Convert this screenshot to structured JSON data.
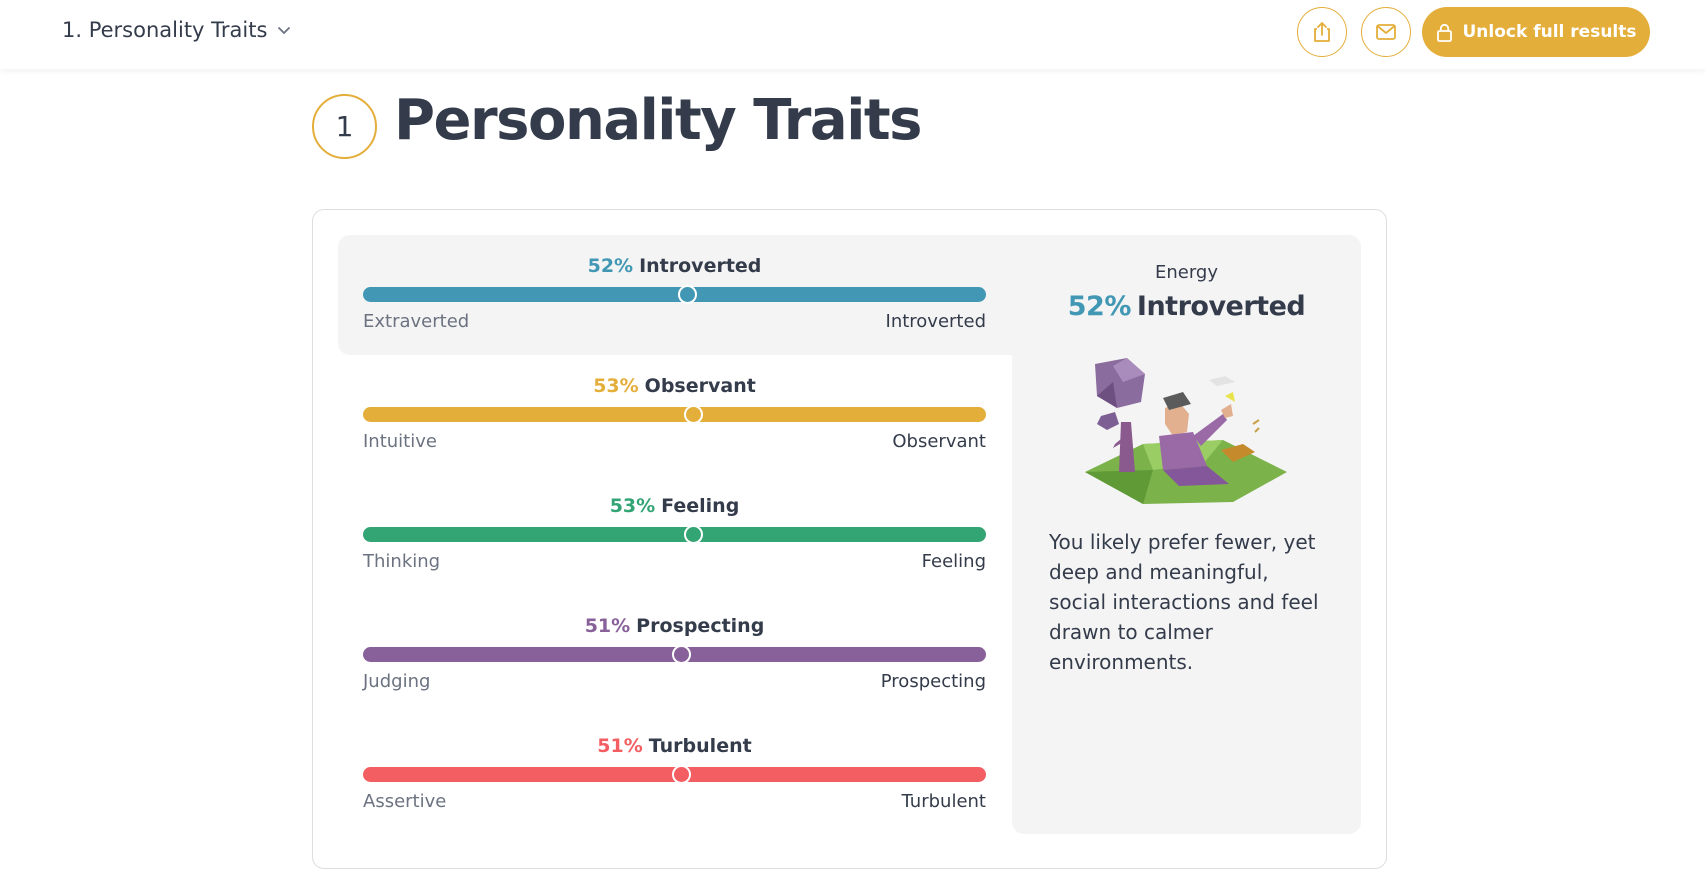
{
  "header": {
    "section_label": "1. Personality Traits",
    "unlock_label": "Unlock full results",
    "accent": "#e4ae3a"
  },
  "title": {
    "number": "1",
    "text": "Personality Traits"
  },
  "traits": [
    {
      "pct": "52%",
      "name": "Introverted",
      "left": "Extraverted",
      "right": "Introverted",
      "color": "#4298b4",
      "level": 52,
      "side": "right",
      "selected": true
    },
    {
      "pct": "53%",
      "name": "Observant",
      "left": "Intuitive",
      "right": "Observant",
      "color": "#e4ae3a",
      "level": 53,
      "side": "right"
    },
    {
      "pct": "53%",
      "name": "Feeling",
      "left": "Thinking",
      "right": "Feeling",
      "color": "#33a474",
      "level": 53,
      "side": "right"
    },
    {
      "pct": "51%",
      "name": "Prospecting",
      "left": "Judging",
      "right": "Prospecting",
      "color": "#88619a",
      "level": 51,
      "side": "right"
    },
    {
      "pct": "51%",
      "name": "Turbulent",
      "left": "Assertive",
      "right": "Turbulent",
      "color": "#f25e62",
      "level": 51,
      "side": "right"
    }
  ],
  "panel": {
    "category": "Energy",
    "pct": "52%",
    "name": "Introverted",
    "description": "You likely prefer fewer, yet deep and meaningful, social interactions and feel drawn to calmer environments."
  }
}
